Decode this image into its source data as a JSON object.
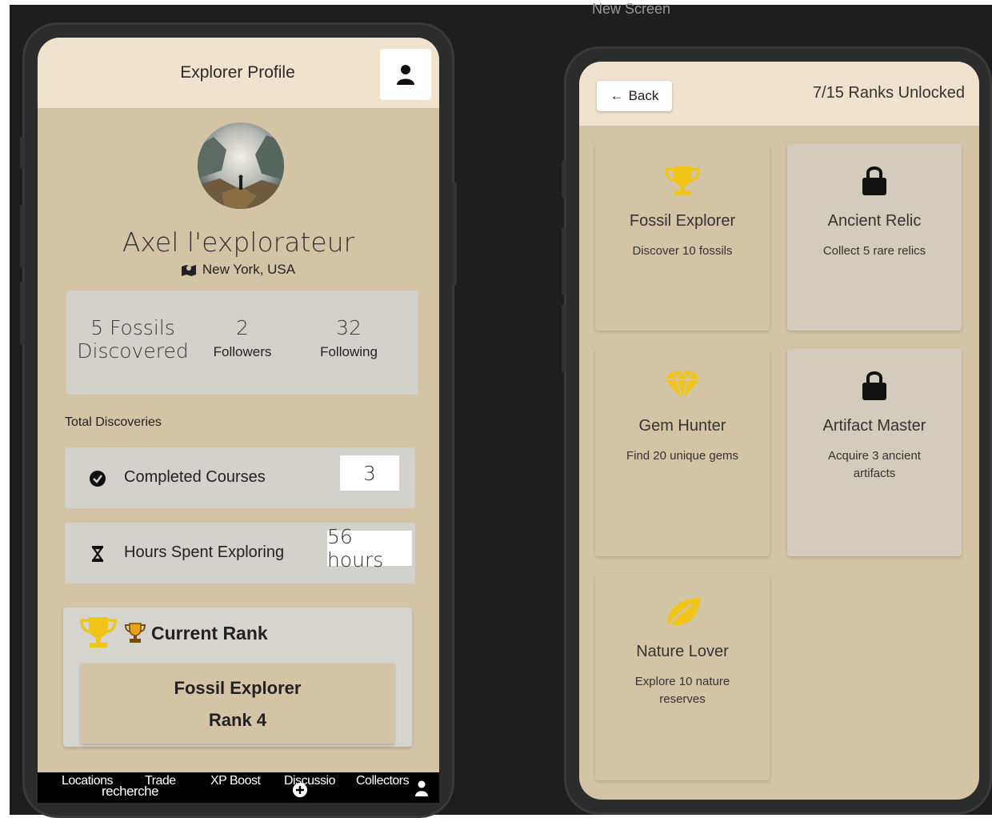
{
  "canvas": {
    "caption": "New Screen"
  },
  "profile_screen": {
    "header": {
      "title": "Explorer Profile",
      "profile_icon": "person-icon"
    },
    "user": {
      "name": "Axel l'explorateur",
      "location": "New York, USA"
    },
    "stats": [
      {
        "value": "5 Fossils",
        "label": "Discovered"
      },
      {
        "value": "2",
        "label": "Followers"
      },
      {
        "value": "32",
        "label": "Following"
      }
    ],
    "total_label": "Total Discoveries",
    "rows": [
      {
        "icon": "check-circle-icon",
        "label": "Completed Courses",
        "value": "3"
      },
      {
        "icon": "hourglass-icon",
        "label": "Hours Spent Exploring",
        "value": "56 hours"
      }
    ],
    "rank": {
      "title": "Current Rank",
      "name": "Fossil Explorer",
      "level": "Rank 4",
      "icon_color": "#f0c419"
    },
    "nav": {
      "items": [
        "Locations",
        "Trade",
        "recherche",
        "XP Boost",
        "Discussio",
        "Collectors"
      ]
    }
  },
  "ranks_screen": {
    "back_label": "Back",
    "count_label": "7/15 Ranks Unlocked",
    "achievements": [
      {
        "name": "Fossil Explorer",
        "desc": "Discover 10 fossils",
        "icon": "trophy-icon",
        "locked": false
      },
      {
        "name": "Ancient Relic",
        "desc": "Collect 5 rare relics",
        "icon": "lock-icon",
        "locked": true
      },
      {
        "name": "Gem Hunter",
        "desc": "Find 20 unique gems",
        "icon": "gem-icon",
        "locked": false
      },
      {
        "name": "Artifact Master",
        "desc": "Acquire 3 ancient artifacts",
        "icon": "lock-icon",
        "locked": true
      },
      {
        "name": "Nature Lover",
        "desc": "Explore 10 nature reserves",
        "icon": "leaf-icon",
        "locked": false
      }
    ]
  },
  "colors": {
    "accent_gold": "#f0c419",
    "beige": "#d4c4a6",
    "header_cream": "#efe3cd",
    "card_grey": "#d3d1cb"
  }
}
